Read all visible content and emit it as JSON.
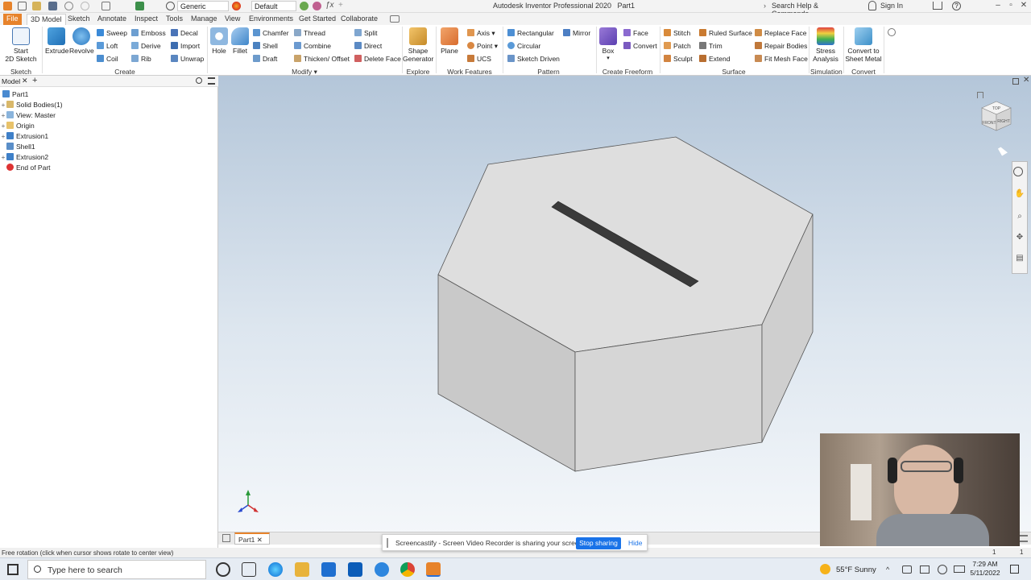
{
  "app": {
    "title": "Autodesk Inventor Professional 2020",
    "document": "Part1"
  },
  "quick_access": {
    "material": "Generic",
    "appearance": "Default"
  },
  "help": {
    "search_placeholder": "Search Help & Commands...",
    "sign_in": "Sign In"
  },
  "tabs": [
    "File",
    "3D Model",
    "Sketch",
    "Annotate",
    "Inspect",
    "Tools",
    "Manage",
    "View",
    "Environments",
    "Get Started",
    "Collaborate"
  ],
  "ribbon": {
    "sketch": {
      "start_label": "Start",
      "sketch_label": "2D Sketch",
      "group": "Sketch"
    },
    "create": {
      "extrude": "Extrude",
      "revolve": "Revolve",
      "sweep": "Sweep",
      "emboss": "Emboss",
      "decal": "Decal",
      "loft": "Loft",
      "derive": "Derive",
      "import": "Import",
      "coil": "Coil",
      "rib": "Rib",
      "unwrap": "Unwrap",
      "group": "Create"
    },
    "modify": {
      "hole": "Hole",
      "fillet": "Fillet",
      "chamfer": "Chamfer",
      "thread": "Thread",
      "split": "Split",
      "shell": "Shell",
      "combine": "Combine",
      "direct": "Direct",
      "draft": "Draft",
      "thicken": "Thicken/ Offset",
      "delete_face": "Delete Face",
      "group": "Modify"
    },
    "explore": {
      "shape1": "Shape",
      "shape2": "Generator",
      "group": "Explore"
    },
    "work_features": {
      "plane": "Plane",
      "axis": "Axis",
      "point": "Point",
      "ucs": "UCS",
      "group": "Work Features"
    },
    "pattern": {
      "rectangular": "Rectangular",
      "mirror": "Mirror",
      "circular": "Circular",
      "sketch_driven": "Sketch Driven",
      "group": "Pattern"
    },
    "freeform": {
      "box": "Box",
      "face": "Face",
      "convert": "Convert",
      "group": "Create Freeform"
    },
    "surface": {
      "stitch": "Stitch",
      "ruled_surface": "Ruled Surface",
      "replace_face": "Replace Face",
      "patch": "Patch",
      "trim": "Trim",
      "repair_bodies": "Repair Bodies",
      "sculpt": "Sculpt",
      "extend": "Extend",
      "fit_mesh_face": "Fit Mesh Face",
      "group": "Surface"
    },
    "simulation": {
      "label1": "Stress",
      "label2": "Analysis",
      "group": "Simulation"
    },
    "convert": {
      "label1": "Convert to",
      "label2": "Sheet Metal",
      "group": "Convert"
    }
  },
  "browser": {
    "tab": "Model",
    "items": [
      "Part1",
      "Solid Bodies(1)",
      "View: Master",
      "Origin",
      "Extrusion1",
      "Shell1",
      "Extrusion2",
      "End of Part"
    ]
  },
  "viewcube": {
    "top": "TOP",
    "front": "FRONT",
    "right": "RIGHT"
  },
  "document_tab": "Part1",
  "status_text": "Free rotation (click when cursor shows rotate to center view)",
  "status_counts": [
    "1",
    "1"
  ],
  "share_bar": {
    "message": "Screencastify - Screen Video Recorder is sharing your screen.",
    "stop": "Stop sharing",
    "hide": "Hide"
  },
  "taskbar": {
    "search_placeholder": "Type here to search",
    "weather": "55°F Sunny",
    "time": "7:29 AM",
    "date": "5/11/2022"
  },
  "colors": {
    "file_tab": "#e7832b",
    "accent_blue": "#1a73e8",
    "viewport_top": "#b4c6d9",
    "viewport_bottom": "#f4f7fa"
  }
}
